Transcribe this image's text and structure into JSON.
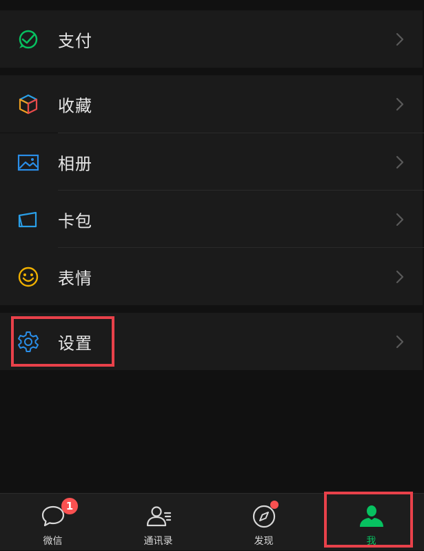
{
  "menu": {
    "pay": {
      "label": "支付",
      "icon": "wechat-pay-icon"
    },
    "favorites": {
      "label": "收藏",
      "icon": "cube-icon"
    },
    "album": {
      "label": "相册",
      "icon": "photo-icon"
    },
    "cards": {
      "label": "卡包",
      "icon": "card-icon"
    },
    "stickers": {
      "label": "表情",
      "icon": "smile-icon"
    },
    "settings": {
      "label": "设置",
      "icon": "gear-icon"
    }
  },
  "tabbar": {
    "chats": {
      "label": "微信",
      "badge": "1",
      "icon": "chat-bubble-icon"
    },
    "contacts": {
      "label": "通讯录",
      "icon": "contacts-icon"
    },
    "discover": {
      "label": "发现",
      "icon": "compass-icon",
      "has_dot": true
    },
    "me": {
      "label": "我",
      "icon": "person-icon",
      "active": true
    }
  },
  "colors": {
    "accent": "#07c160",
    "highlight": "#e8414a",
    "badge": "#fa5151"
  }
}
